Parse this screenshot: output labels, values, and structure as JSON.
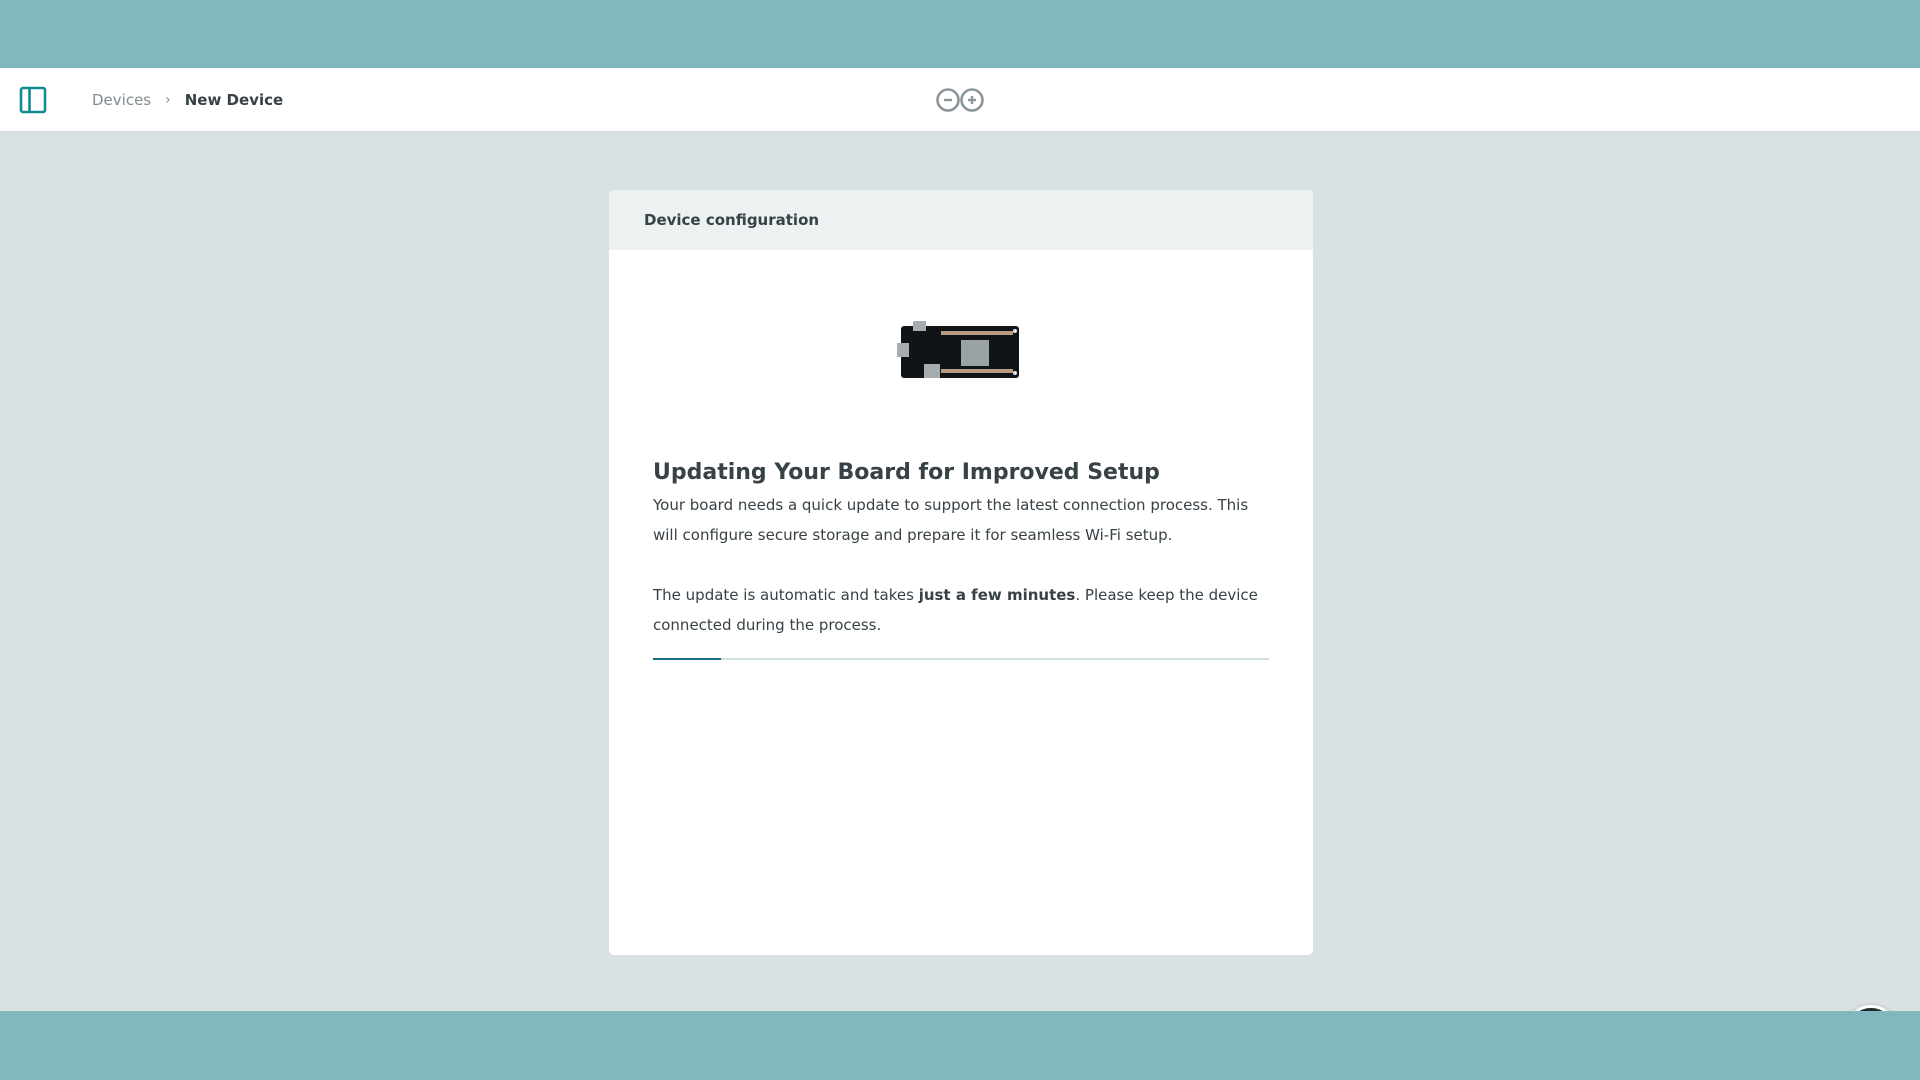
{
  "breadcrumb": {
    "parent": "Devices",
    "current": "New Device"
  },
  "card": {
    "header": "Device configuration",
    "title": "Updating Your Board for Improved Setup",
    "paragraph1": "Your board needs a quick update to support the latest connection process. This will configure secure storage and prepare it for seamless Wi-Fi setup.",
    "paragraph2_before": "The update is automatic and takes ",
    "paragraph2_bold": "just a few minutes",
    "paragraph2_after": ". Please keep the device connected during the process.",
    "progress_fraction": 0.11
  },
  "icons": {
    "sidebar_toggle": "sidebar-toggle-icon",
    "logo": "arduino-logo",
    "board": "board-image",
    "chat": "chat-assistant-icon"
  },
  "colors": {
    "accent": "#0f8b96",
    "progress": "#1a6e82",
    "text": "#374146",
    "muted": "#7f8c8f"
  }
}
